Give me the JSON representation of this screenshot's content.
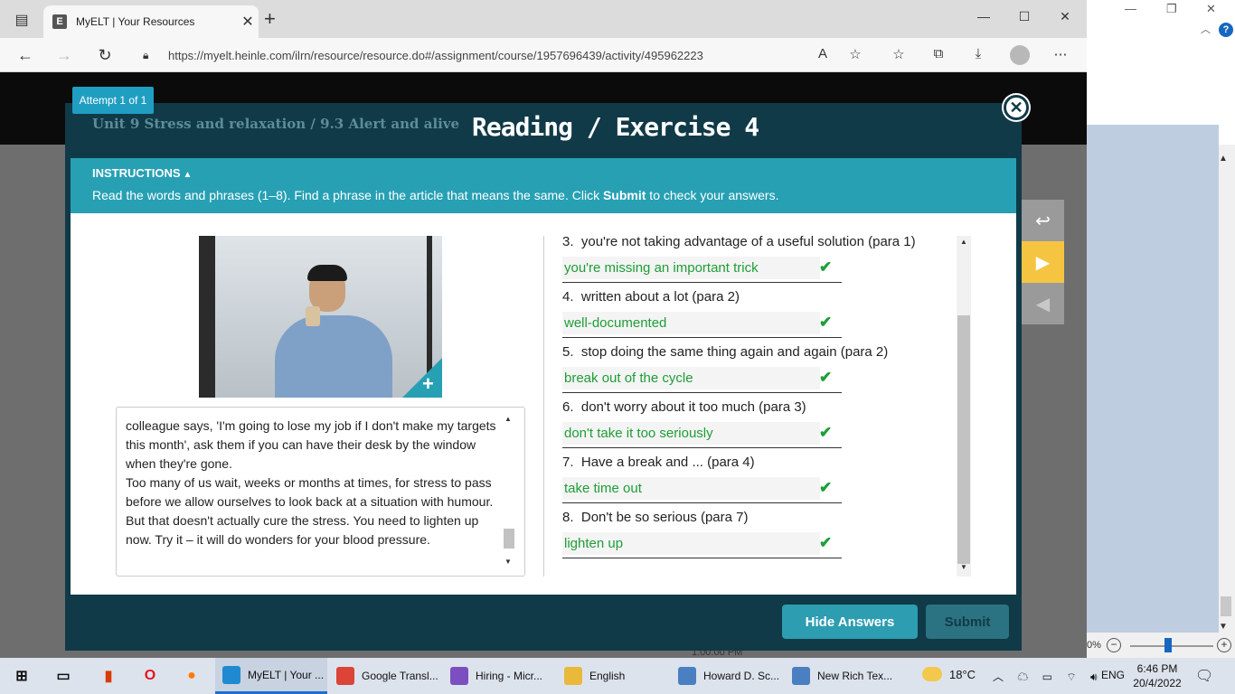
{
  "browser": {
    "tab_title": "MyELT | Your Resources",
    "tab_favicon_letter": "E",
    "url": "https://myelt.heinle.com/ilrn/resource/resource.do#/assignment/course/1957696439/activity/495962223"
  },
  "page": {
    "bottom_text": "1:00:00 PM"
  },
  "modal": {
    "attempt": "Attempt 1 of 1",
    "breadcrumb": "Unit 9 Stress and relaxation / 9.3 Alert and alive",
    "title": "Reading / Exercise 4",
    "instructions_label": "INSTRUCTIONS",
    "instructions_text_before": "Read the words and phrases (1–8). Find a phrase in the article that means the same. Click ",
    "instructions_text_bold": "Submit",
    "instructions_text_after": " to check your answers.",
    "article": [
      "colleague says, 'I'm going to lose my job if I don't make my targets this month', ask them if you can have their desk by the window when they're gone.",
      "Too many of us wait, weeks or months at times, for stress to pass before we allow ourselves to look back at a situation with humour. But that doesn't actually cure the stress. You need to lighten up now. Try it – it will do wonders for your blood pressure."
    ],
    "questions": [
      {
        "number": "3.",
        "prompt": "you're not taking advantage of a useful solution (para 1)",
        "answer": "you're missing an important trick"
      },
      {
        "number": "4.",
        "prompt": "written about a lot (para 2)",
        "answer": "well-documented"
      },
      {
        "number": "5.",
        "prompt": "stop doing the same thing again and again (para 2)",
        "answer": "break out of the cycle"
      },
      {
        "number": "6.",
        "prompt": "don't worry about it too much (para 3)",
        "answer": "don't take it too seriously"
      },
      {
        "number": "7.",
        "prompt": "Have a break and ... (para 4)",
        "answer": "take time out"
      },
      {
        "number": "8.",
        "prompt": "Don't be so serious (para 7)",
        "answer": "lighten up"
      }
    ],
    "hide_answers_label": "Hide Answers",
    "submit_label": "Submit"
  },
  "right_window": {
    "zoom_percent": "0%"
  },
  "taskbar": {
    "apps": [
      {
        "label": "MyELT | Your ...",
        "icon": "edge-icon"
      },
      {
        "label": "Google Transl...",
        "icon": "chrome-icon"
      },
      {
        "label": "Hiring - Micr...",
        "icon": "visual-studio-icon"
      },
      {
        "label": "English",
        "icon": "folder-icon"
      },
      {
        "label": "Howard D. Sc...",
        "icon": "document-icon"
      },
      {
        "label": "New Rich Tex...",
        "icon": "document-icon"
      }
    ],
    "temperature": "18°C",
    "language": "ENG",
    "time": "6:46 PM",
    "date": "20/4/2022"
  },
  "colors": {
    "modal_dark": "#103a47",
    "instruction_teal": "#27a0b4",
    "answer_green": "#1e9e37",
    "side_next_gold": "#f5c542"
  }
}
